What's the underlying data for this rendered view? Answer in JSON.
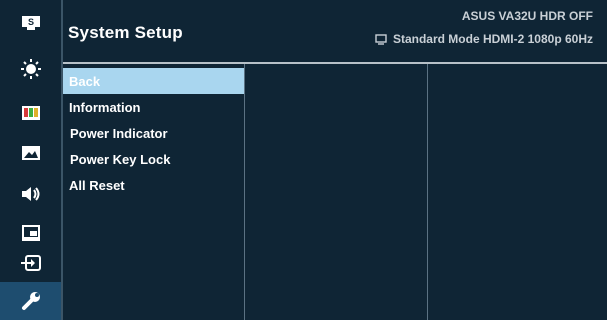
{
  "header": {
    "title": "System Setup",
    "model": "ASUS  VA32U HDR OFF",
    "status": "Standard Mode  HDMI-2  1080p  60Hz",
    "status_icon": "monitor-icon"
  },
  "rail": {
    "items": [
      {
        "name": "splendid-icon",
        "glyph": "S"
      },
      {
        "name": "brightness-icon"
      },
      {
        "name": "color-icon"
      },
      {
        "name": "image-icon"
      },
      {
        "name": "sound-icon"
      },
      {
        "name": "pip-icon"
      },
      {
        "name": "input-select-icon"
      },
      {
        "name": "system-setup-icon",
        "active": true
      }
    ]
  },
  "menu": {
    "items": [
      {
        "label": "Back"
      },
      {
        "label": "Information"
      },
      {
        "label": "Power Indicator"
      },
      {
        "label": "Power Key Lock"
      },
      {
        "label": "All Reset"
      }
    ]
  },
  "colors": {
    "background": "#0f2535",
    "selected": "#a9d6ef",
    "active_rail": "#1e4d6f",
    "text": "#ffffff",
    "muted_text": "#c9d0d6"
  }
}
